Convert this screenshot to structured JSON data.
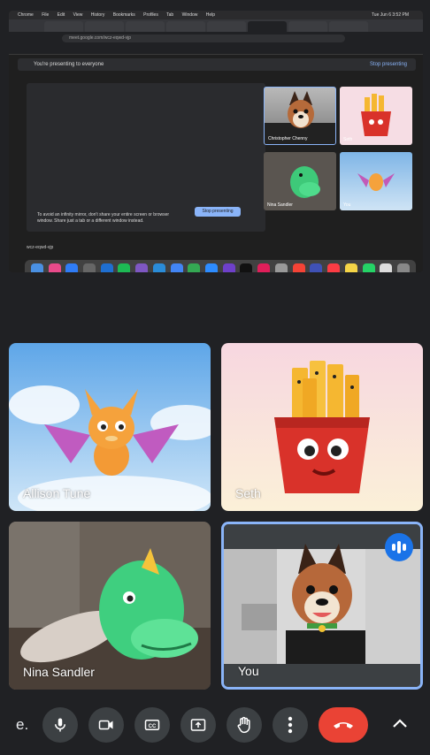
{
  "screen_share": {
    "menu_bar": [
      "Chrome",
      "File",
      "Edit",
      "View",
      "History",
      "Bookmarks",
      "Profiles",
      "Tab",
      "Window",
      "Help"
    ],
    "clock": "Tue Jun 6 3:52 PM",
    "url": "meet.google.com/wcz-eqwd-vjp",
    "banner_text": "You're presenting to everyone",
    "banner_stop": "Stop presenting",
    "stop_button": "Stop presenting",
    "hint_text": "To avoid an infinity mirror, don't share your entire screen or browser window. Share just a tab or a different window instead.",
    "participants": [
      {
        "name": "Christopher Chenny"
      },
      {
        "name": "Seth"
      },
      {
        "name": "Nina Sandler"
      },
      {
        "name": "You"
      }
    ],
    "footer_code": "wcz-eqwd-vjp"
  },
  "tiles": [
    {
      "name": "Allison Tune"
    },
    {
      "name": "Seth"
    },
    {
      "name": "Nina Sandler"
    },
    {
      "name": "You"
    }
  ],
  "controls": {
    "meeting_code": "e.",
    "icons": [
      "mic-icon",
      "camera-icon",
      "captions-icon",
      "present-icon",
      "raise-hand-icon",
      "more-icon",
      "leave-call-icon",
      "chevron-up-icon"
    ]
  },
  "colors": {
    "background": "#202124",
    "control_button": "#3c4043",
    "leave_button": "#ea4335",
    "active_speaker_border": "#8ab4f8",
    "speaking_badge": "#1a73e8"
  }
}
